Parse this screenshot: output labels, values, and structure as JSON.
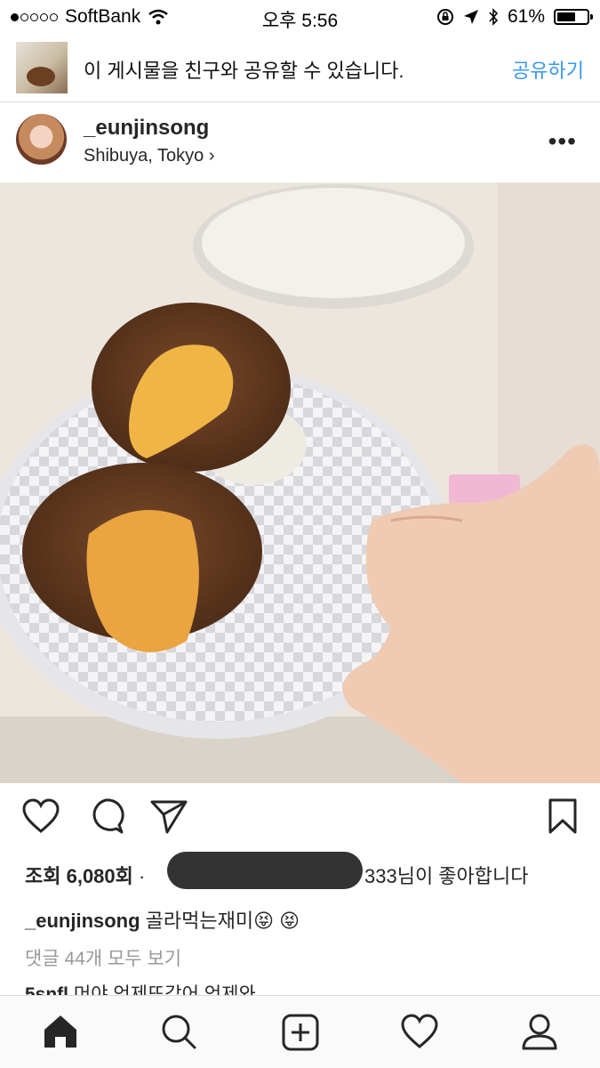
{
  "status_bar": {
    "carrier": "SoftBank",
    "time": "오후 5:56",
    "battery": "61%",
    "battery_level": 0.61,
    "signal_dots_filled": 1
  },
  "share_banner": {
    "message": "이 게시물을 친구와 공유할 수 있습니다.",
    "share_label": "공유하기"
  },
  "post": {
    "username": "_eunjinsong",
    "location": "Shibuya, Tokyo ›",
    "more_label": "•••"
  },
  "engagement": {
    "views": "조회 6,080회",
    "separator": " ·",
    "likes_suffix": "333님이 좋아합니다",
    "caption_username": "_eunjinsong",
    "caption_text": " 골라먹는재미😝 😝",
    "view_comments": "댓글 44개 모두 보기",
    "comment_username": "5snfl",
    "comment_text": " 머야 언제또갔어 언제와"
  },
  "icons": {
    "action_bar": [
      "heart-icon",
      "comment-icon",
      "send-icon",
      "bookmark-icon"
    ],
    "tab_bar": [
      "home-icon",
      "search-icon",
      "add-icon",
      "activity-heart-icon",
      "profile-icon"
    ]
  },
  "colors": {
    "accent": "#3897f0",
    "text": "#262626",
    "muted": "#999999"
  }
}
